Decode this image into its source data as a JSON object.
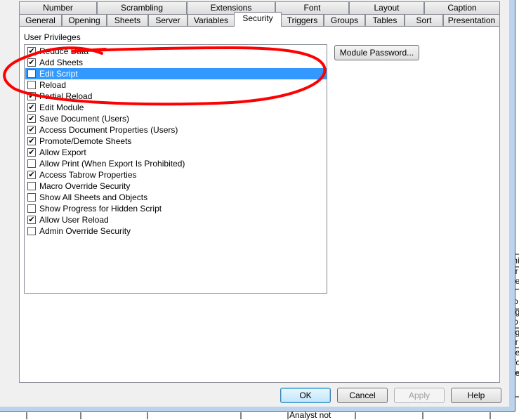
{
  "tabs_row1": [
    "Number",
    "Scrambling",
    "Extensions",
    "Font",
    "Layout",
    "Caption"
  ],
  "tabs_row2": [
    "General",
    "Opening",
    "Sheets",
    "Server",
    "Variables",
    "Security",
    "Triggers",
    "Groups",
    "Tables",
    "Sort",
    "Presentation"
  ],
  "active_tab": "Security",
  "privileges_label": "User Privileges",
  "privileges": [
    {
      "label": "Reduce Data",
      "checked": true
    },
    {
      "label": "Add Sheets",
      "checked": true
    },
    {
      "label": "Edit Script",
      "checked": false,
      "selected": true
    },
    {
      "label": "Reload",
      "checked": false
    },
    {
      "label": "Partial Reload",
      "checked": true
    },
    {
      "label": "Edit Module",
      "checked": true
    },
    {
      "label": "Save Document (Users)",
      "checked": true
    },
    {
      "label": "Access Document Properties (Users)",
      "checked": true
    },
    {
      "label": "Promote/Demote Sheets",
      "checked": true
    },
    {
      "label": "Allow Export",
      "checked": true
    },
    {
      "label": "Allow Print (When Export Is Prohibited)",
      "checked": false
    },
    {
      "label": "Access Tabrow Properties",
      "checked": true
    },
    {
      "label": "Macro Override Security",
      "checked": false
    },
    {
      "label": "Show All Sheets and Objects",
      "checked": false
    },
    {
      "label": "Show Progress for Hidden Script",
      "checked": false
    },
    {
      "label": "Allow User Reload",
      "checked": true
    },
    {
      "label": "Admin Override Security",
      "checked": false
    }
  ],
  "module_password_label": "Module Password...",
  "buttons": {
    "ok": "OK",
    "cancel": "Cancel",
    "apply": "Apply",
    "help": "Help"
  },
  "background_fragments": [
    "mi",
    "er",
    "pe",
    "g",
    "rp",
    "ug",
    "rp",
    "ug",
    "er",
    "pe",
    "Vo",
    "pe",
    "g",
    "Analyst not"
  ],
  "annotation_color": "#ff0000"
}
